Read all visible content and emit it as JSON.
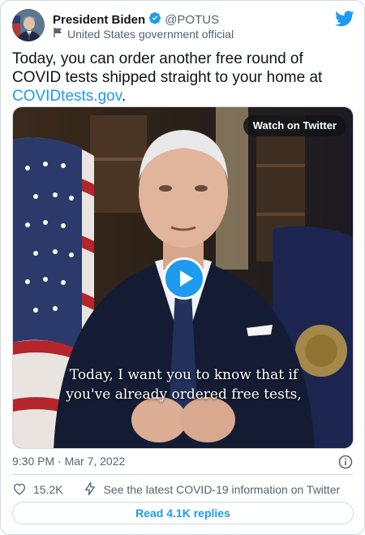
{
  "author": {
    "name": "President Biden",
    "handle": "@POTUS",
    "label": "United States government official"
  },
  "tweet": {
    "text_before_link": "Today, you can order another free round of COVID tests shipped straight to your home at ",
    "link_text": "COVIDtests.gov",
    "text_after_link": "."
  },
  "media": {
    "watch_label": "Watch on Twitter",
    "caption_line1": "Today, I want you to know that if",
    "caption_line2": "you've already ordered free tests,"
  },
  "meta": {
    "timestamp": "9:30 PM · Mar 7, 2022"
  },
  "actions": {
    "like_count": "15.2K",
    "covid_info": "See the latest COVID-19 information on Twitter"
  },
  "replies_button": "Read 4.1K replies",
  "colors": {
    "accent": "#1d9bf0",
    "text": "#0f1419",
    "muted": "#536471",
    "border": "#cfd9de"
  }
}
